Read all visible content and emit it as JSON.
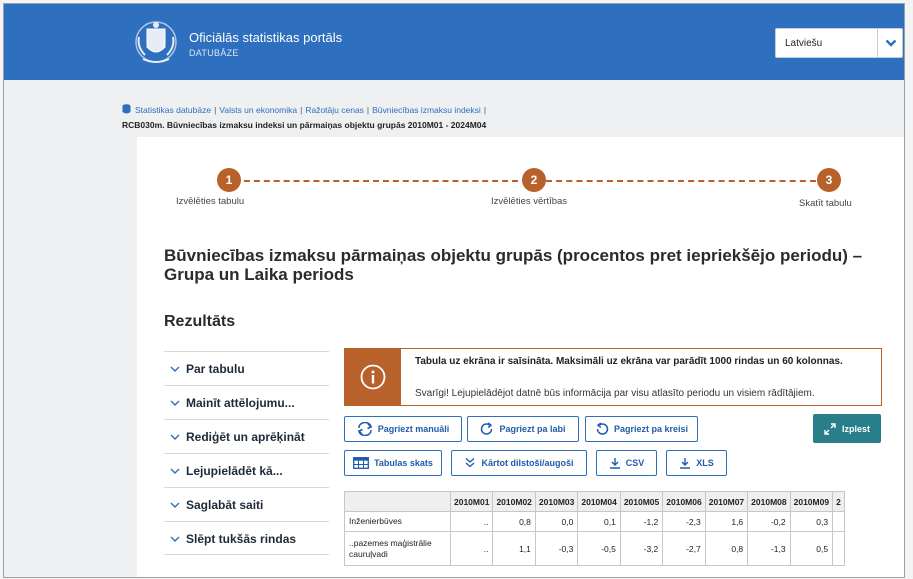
{
  "header": {
    "title": "Oficiālās statistikas portāls",
    "subtitle": "DATUBĀZE",
    "language": "Latviešu"
  },
  "breadcrumb": {
    "items": [
      "Statistikas datubāze",
      "Valsts un ekonomika",
      "Ražotāju cenas",
      "Būvniecības izmaksu indeksi"
    ],
    "trailing_sep": "|",
    "table_id": "RCB030m. Būvniecības izmaksu indeksi un pārmaiņas objektu grupās 2010M01 - 2024M04"
  },
  "steps": [
    {
      "number": "1",
      "label": "Izvēlēties tabulu"
    },
    {
      "number": "2",
      "label": "Izvēlēties vērtības"
    },
    {
      "number": "3",
      "label": "Skatīt tabulu"
    }
  ],
  "main_title": "Būvniecības izmaksu pārmaiņas objektu grupās (procentos pret iepriekšējo periodu) – Grupa un Laika periods",
  "section_title": "Rezultāts",
  "side_menu": [
    "Par tabulu",
    "Mainīt attēlojumu...",
    "Rediģēt un aprēķināt",
    "Lejupielādēt kā...",
    "Saglabāt saiti",
    "Slēpt tukšās rindas"
  ],
  "notice": {
    "bold": "Tabula uz ekrāna ir saīsināta. Maksimāli uz ekrāna var parādīt 1000 rindas un 60 kolonnas.",
    "text": "Svarīgi! Lejupielādējot datnē būs informācija par visu atlasīto periodu un visiem rādītājiem."
  },
  "buttons": {
    "pivot_manual": "Pagriezt manuāli",
    "pivot_right": "Pagriezt pa labi",
    "pivot_left": "Pagriezt pa kreisi",
    "expand": "Izplest",
    "table_view": "Tabulas skats",
    "sort": "Kārtot dilstoši/augoši",
    "csv": "CSV",
    "xls": "XLS"
  },
  "table": {
    "columns": [
      "2010M01",
      "2010M02",
      "2010M03",
      "2010M04",
      "2010M05",
      "2010M06",
      "2010M07",
      "2010M08",
      "2010M09",
      "2"
    ],
    "rows": [
      {
        "label": "Inženierbūves",
        "values": [
          "..",
          "0,8",
          "0,0",
          "0,1",
          "-1,2",
          "-2,3",
          "1,6",
          "-0,2",
          "0,3"
        ]
      },
      {
        "label": "..pazemes maģistrālie cauruļvadi",
        "values": [
          "..",
          "1,1",
          "-0,3",
          "-0,5",
          "-3,2",
          "-2,7",
          "0,8",
          "-1,3",
          "0,5"
        ]
      }
    ]
  },
  "colors": {
    "header_blue": "#2f6fbf",
    "accent_brown": "#b8612a",
    "expand_teal": "#287f8a"
  },
  "icons": {
    "logo": "latvia-coat-of-arms",
    "language_dropdown": "chevron-down-icon",
    "breadcrumb": "database-icon",
    "notice": "info-icon",
    "side_menu": "chevron-down-icon",
    "pivot_manual": "rotate-icon",
    "pivot_right": "rotate-clockwise-icon",
    "pivot_left": "rotate-counterclockwise-icon",
    "expand": "expand-arrows-icon",
    "table_view": "table-icon",
    "sort": "double-chevron-down-icon",
    "download": "download-icon"
  }
}
